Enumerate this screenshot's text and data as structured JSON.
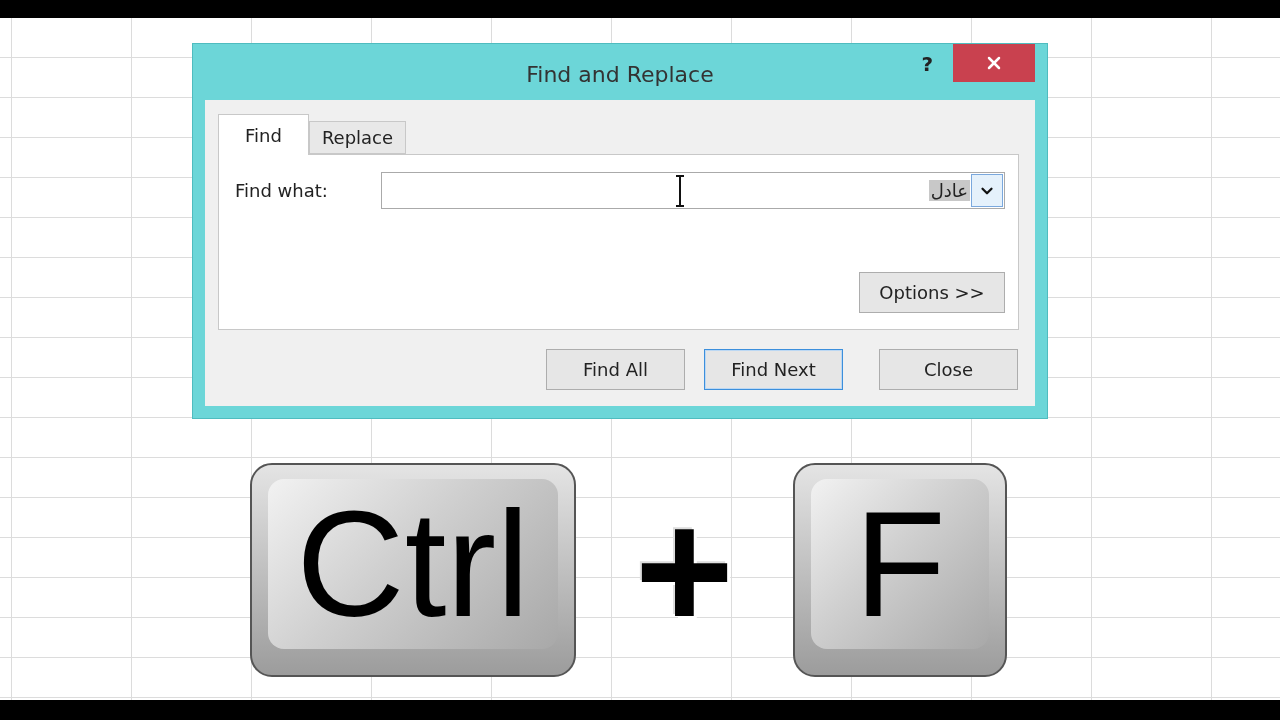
{
  "dialog": {
    "title": "Find and Replace",
    "help": "?"
  },
  "tabs": [
    {
      "label": "Find",
      "selected": true
    },
    {
      "label": "Replace",
      "selected": false
    }
  ],
  "find_what": {
    "label": "Find what:",
    "value": "عادل",
    "text_selected": true
  },
  "options_button": "Options >>",
  "buttons": [
    {
      "label": "Find All",
      "focused": false
    },
    {
      "label": "Find Next",
      "focused": true
    },
    {
      "label": "Close",
      "focused": false
    }
  ],
  "shortcut": {
    "keys": [
      "Ctrl",
      "F"
    ],
    "joiner": "+"
  }
}
